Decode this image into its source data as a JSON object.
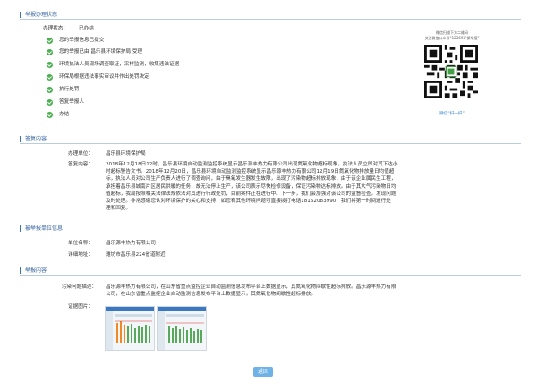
{
  "colors": {
    "accent": "#3a73b8",
    "check": "#4caf50",
    "button": "#6fb2e6"
  },
  "sections": {
    "status": "举报办理状态",
    "content": "答复内容",
    "reported": "被举报单位信息",
    "report": "举报内容"
  },
  "status": {
    "label": "办理状态：",
    "value": "已办结",
    "steps": [
      "您的举报信息已提交",
      "您的举报已由 昌乐县环境保护局 受理",
      "环境执法人员现场调查取证，采样监测，收集违法证据",
      "环保局根据违法事实审议并作出处罚决定",
      "执行处罚",
      "答复举报人",
      "办结"
    ]
  },
  "qr": {
    "caption_line1": "微信扫描下方二维码",
    "caption_line2": "关注微信公众号“12369环保举报”",
    "scan_label": "微信“扫一扫”"
  },
  "reply": {
    "unit_label": "办理单位：",
    "unit_value": "昌乐县环境保护局",
    "content_label": "答复内容：",
    "lines": [
      "2018年12月18日12时，昌乐县环境自动监测监控系统显示昌乐源丰热力有限公司出现氮氧化物超标现象，执法人员立即对其下达小",
      "时超标警告文书。2018年12月20日，昌乐县环境自动监测监控系统显示昌乐源丰热力有限公司12月19日氮氧化物排放量日均值超",
      "标，执法人员对公司生产负责人进行了调查询问，由于臭氧发生器发生故障，出现了污染物超标排放现象，由于该企业属民生工程，",
      "承担着昌乐县城南片区居民供暖的任务，故无法停止生产，该公司表示尽快检修设备，保证污染物达标排放。由于其大气污染物日均",
      "值超标，我局按照相关法律法规依法对其进行行政处罚，目前案件正在进行中。下一步，我们会加强对该公司的监督检查，发现问题",
      "及时处理。非常感谢您认对环境保护的关心和支持，如您有其他环境问题可直接拨打电话18162083990，我们将第一时间进行处",
      "理和回复。"
    ]
  },
  "reported": {
    "name_label": "单位名称：",
    "name_value": "昌乐源丰热力有限公司",
    "address_label": "详细地址：",
    "address_value": "潍坊市昌乐县224省道附近"
  },
  "report": {
    "desc_label": "污染问题描述：",
    "desc_lines": [
      "昌乐源丰热力有限公司，在山东省重点监控企业自动监测信息发布平台上数据显示，其氮氧化物间歇性超标排放。昌乐源丰热力有限",
      "公司，在山东省重点监控企业自动监测信息发布平台上数据显示，其氮氧化物间歇性超标排放。"
    ],
    "evidence_label": "证据图片："
  },
  "buttons": {
    "back": "返回"
  }
}
